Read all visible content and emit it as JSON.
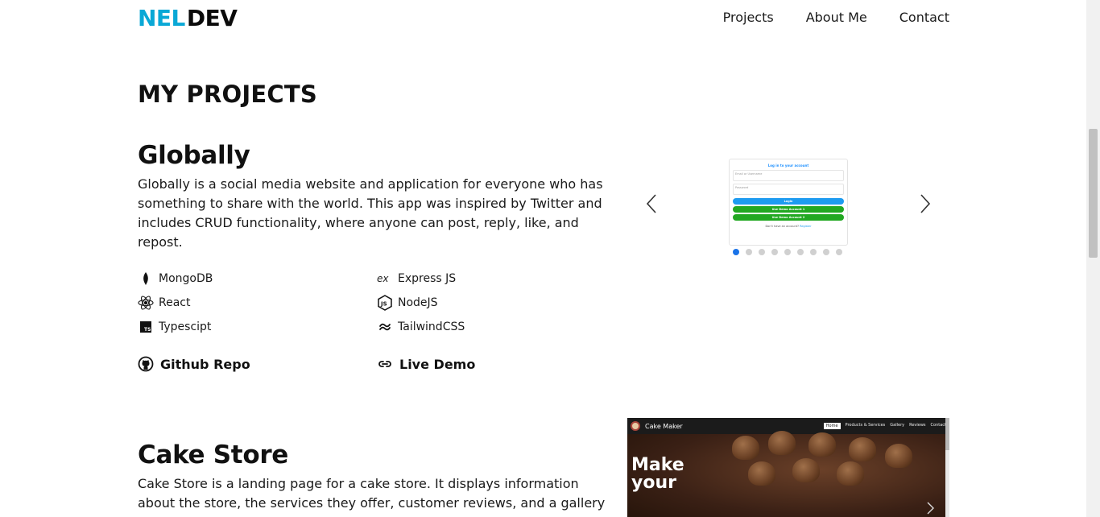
{
  "nav": {
    "logo_part1": "NEL",
    "logo_part2": "DEV",
    "links": [
      "Projects",
      "About Me",
      "Contact"
    ]
  },
  "colors": {
    "brand_accent": "#0aa8d6",
    "carousel_active_dot": "#1a73e8",
    "login_blue": "#1d9bf0",
    "demo_green": "#22a822"
  },
  "section_title": "MY PROJECTS",
  "projects": [
    {
      "title": "Globally",
      "description": "Globally is a social media website and application for everyone who has something to share with the world. This app was inspired by Twitter and includes CRUD functionality, where anyone can post, reply, like, and repost.",
      "tech": [
        {
          "name": "MongoDB",
          "icon": "mongodb-icon"
        },
        {
          "name": "Express JS",
          "icon": "express-icon"
        },
        {
          "name": "React",
          "icon": "react-icon"
        },
        {
          "name": "NodeJS",
          "icon": "nodejs-icon"
        },
        {
          "name": "Typescipt",
          "icon": "typescript-icon"
        },
        {
          "name": "TailwindCSS",
          "icon": "tailwind-icon"
        }
      ],
      "links": {
        "repo": "Github Repo",
        "demo": "Live Demo"
      },
      "screenshot": {
        "title": "Log in to your account",
        "username_placeholder": "Email or Username",
        "password_placeholder": "Password",
        "login_button": "Login",
        "demo1_button": "Use Demo Account 1",
        "demo2_button": "Use Demo Account 2",
        "footer_text": "Don't have an account?",
        "footer_link": "Register"
      },
      "carousel": {
        "slide_count": 9,
        "active_index": 0
      }
    },
    {
      "title": "Cake Store",
      "description": "Cake Store is a landing page for a cake store. It displays information about the store, the services they offer, customer reviews, and a gallery",
      "screenshot": {
        "brand": "Cake Maker",
        "menu": [
          "Home",
          "Products & Services",
          "Gallery",
          "Reviews",
          "Contact"
        ],
        "headline_line1": "Make",
        "headline_line2": "your"
      }
    }
  ]
}
